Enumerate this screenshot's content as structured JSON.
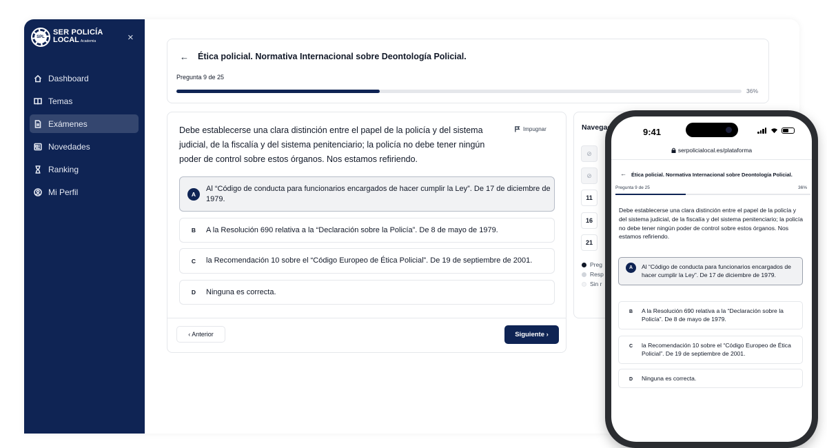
{
  "colors": {
    "brand_navy": "#0f2454",
    "active_nav": "#34466f",
    "border": "#e5e7eb"
  },
  "brand": {
    "logo_line1": "SER POLICÍA",
    "logo_line2": "LOCAL",
    "logo_sub": "Academia",
    "close_glyph": "×"
  },
  "sidebar": {
    "items": [
      {
        "label": "Dashboard",
        "icon": "home-icon",
        "active": false
      },
      {
        "label": "Temas",
        "icon": "book-icon",
        "active": false
      },
      {
        "label": "Exámenes",
        "icon": "document-icon",
        "active": true
      },
      {
        "label": "Novedades",
        "icon": "newspaper-icon",
        "active": false
      },
      {
        "label": "Ranking",
        "icon": "hourglass-icon",
        "active": false
      },
      {
        "label": "Mi Perfil",
        "icon": "user-circle-icon",
        "active": false
      }
    ]
  },
  "exam": {
    "back_glyph": "←",
    "title": "Ética policial. Normativa Internacional sobre Deontología Policial.",
    "counter": "Pregunta 9 de 25",
    "progress_fraction": 0.36,
    "progress_label": "36%"
  },
  "question": {
    "text": "Debe establecerse una clara distinción entre el papel de la policía y del sistema judicial, de la fiscalía y del sistema penitenciario; la policía no debe tener ningún poder de control sobre estos órganos. Nos estamos refiriendo.",
    "impugnar_label": "Impugnar",
    "options": [
      {
        "letter": "A",
        "text": "Al “Código de conducta para funcionarios encargados de hacer cumplir la Ley”. De 17 de diciembre de 1979.",
        "selected": true
      },
      {
        "letter": "B",
        "text": "A la Resolución 690 relativa a la “Declaración sobre la Policía”. De 8 de mayo de 1979.",
        "selected": false
      },
      {
        "letter": "C",
        "text": "la Recomendación 10 sobre el “Código Europeo de Ética Policial”. De 19 de septiembre de 2001.",
        "selected": false
      },
      {
        "letter": "D",
        "text": "Ninguna es correcta.",
        "selected": false
      }
    ],
    "prev_label": "‹  Anterior",
    "next_label": "Siguiente  ›"
  },
  "navigation_panel": {
    "title": "Navegac",
    "cells": [
      {
        "label": "⊘",
        "state": "answered"
      },
      {
        "label": "⊘",
        "state": "answered"
      },
      {
        "label": "11",
        "state": "pending"
      },
      {
        "label": "16",
        "state": "pending"
      },
      {
        "label": "21",
        "state": "pending"
      }
    ],
    "legend": [
      {
        "label": "Preg",
        "color": "#111827"
      },
      {
        "label": "Resp",
        "color": "#d1d5db"
      },
      {
        "label": "Sin r",
        "color": "#f3f4f6"
      }
    ]
  },
  "mobile": {
    "time": "9:41",
    "url": "serpolicialocal.es/plataforma",
    "back_glyph": "←",
    "title": "Ética policial. Normativa Internacional sobre Deontología Policial.",
    "counter": "Pregunta 9 de 25",
    "progress_label": "36%",
    "progress_fraction": 0.36,
    "question_text": "Debe establecerse una clara distinción entre el papel de la policía y del sistema judicial, de la fiscalía y del sistema penitenciario; la policía no debe tener ningún poder de control sobre estos órganos. Nos estamos refiriendo.",
    "options": [
      {
        "letter": "A",
        "text": "Al “Código de conducta para funcionarios encargados de hacer cumplir la Ley”. De 17 de diciembre de 1979.",
        "selected": true
      },
      {
        "letter": "B",
        "text": "A la Resolución 690 relativa a la “Declaración sobre la Policía”. De 8 de mayo de 1979.",
        "selected": false
      },
      {
        "letter": "C",
        "text": "la Recomendación 10 sobre el “Código Europeo de Ética Policial”. De 19 de septiembre de 2001.",
        "selected": false
      },
      {
        "letter": "D",
        "text": "Ninguna es correcta.",
        "selected": false
      }
    ]
  }
}
